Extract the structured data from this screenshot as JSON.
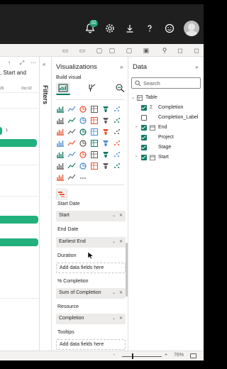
{
  "topbar": {
    "notification_count": "32",
    "icons": [
      "bell-icon",
      "gear-icon",
      "download-icon",
      "help-icon",
      "smiley-icon"
    ]
  },
  "canvas": {
    "chart_title_partial": ", Start and",
    "date_left": "26",
    "date_right": "Oct 02",
    "bar_value": "1"
  },
  "filters": {
    "label": "Filters"
  },
  "visualizations": {
    "title": "Visualizations",
    "build_visual": "Build visual",
    "more": "...",
    "wells": [
      {
        "label": "Start Date",
        "field": "Start"
      },
      {
        "label": "End Date",
        "field": "Earliest End"
      },
      {
        "label": "Duration",
        "placeholder": "Add data fields here"
      },
      {
        "label": "% Completion",
        "field": "Sum of Completion"
      },
      {
        "label": "Resource",
        "field": "Completion"
      },
      {
        "label": "Tooltips",
        "placeholder": "Add data fields here"
      }
    ]
  },
  "data": {
    "title": "Data",
    "search_placeholder": "Search",
    "tree": {
      "table": "Table",
      "fields": [
        {
          "name": "Completion",
          "checked": true,
          "type": "sigma"
        },
        {
          "name": "Completion_Label",
          "checked": false,
          "type": "text"
        },
        {
          "name": "End",
          "checked": true,
          "type": "date",
          "expandable": true
        },
        {
          "name": "Project",
          "checked": true,
          "type": "text"
        },
        {
          "name": "Stage",
          "checked": true,
          "type": "text"
        },
        {
          "name": "Start",
          "checked": true,
          "type": "date",
          "expandable": true
        }
      ]
    }
  },
  "status": {
    "zoom_minus": "-",
    "zoom_plus": "+",
    "zoom": "76%"
  },
  "colors": {
    "accent": "#117865",
    "gantt_bar": "#22b07d",
    "badge": "#20a070",
    "topbar": "#1f1f1f"
  }
}
